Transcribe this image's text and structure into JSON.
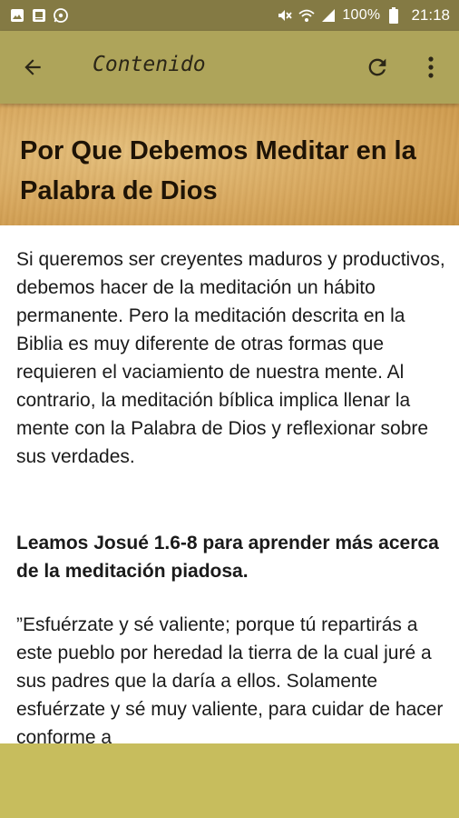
{
  "status_bar": {
    "battery": "100%",
    "time": "21:18",
    "icons_left": [
      "image-icon",
      "gallery-icon",
      "whatsapp-icon"
    ],
    "icons_right": [
      "mute-icon",
      "wifi-icon",
      "signal-icon",
      "battery-icon"
    ]
  },
  "app_bar": {
    "title": "Contenido",
    "actions": [
      "back-arrow-icon",
      "refresh-icon",
      "more-vert-icon"
    ]
  },
  "article": {
    "title": "Por Que Debemos Meditar en la Palabra de Dios",
    "paragraph_1": "Si queremos ser creyentes maduros y productivos, debemos hacer de la meditación un hábito permanente. Pero la meditación descrita en la Biblia es muy diferente de otras formas que requieren el vaciamiento de nuestra mente. Al contrario, la meditación bíblica implica llenar la mente con la Palabra de Dios y reflexionar sobre sus verdades.",
    "heading_2": "Leamos Josué 1.6-8 para aprender más acerca de la meditación piadosa.",
    "quote": "”Esfuérzate y sé valiente; porque tú repartirás a este pueblo por heredad la tierra de la cual juré a sus padres que la daría a ellos. Solamente esfuérzate y sé muy valiente, para cuidar de hacer conforme a"
  },
  "colors": {
    "status_bar": "#847a44",
    "app_bar": "#aea45a",
    "header_parchment": "#d7a75e",
    "bottom_bar": "#c7bd5d"
  }
}
